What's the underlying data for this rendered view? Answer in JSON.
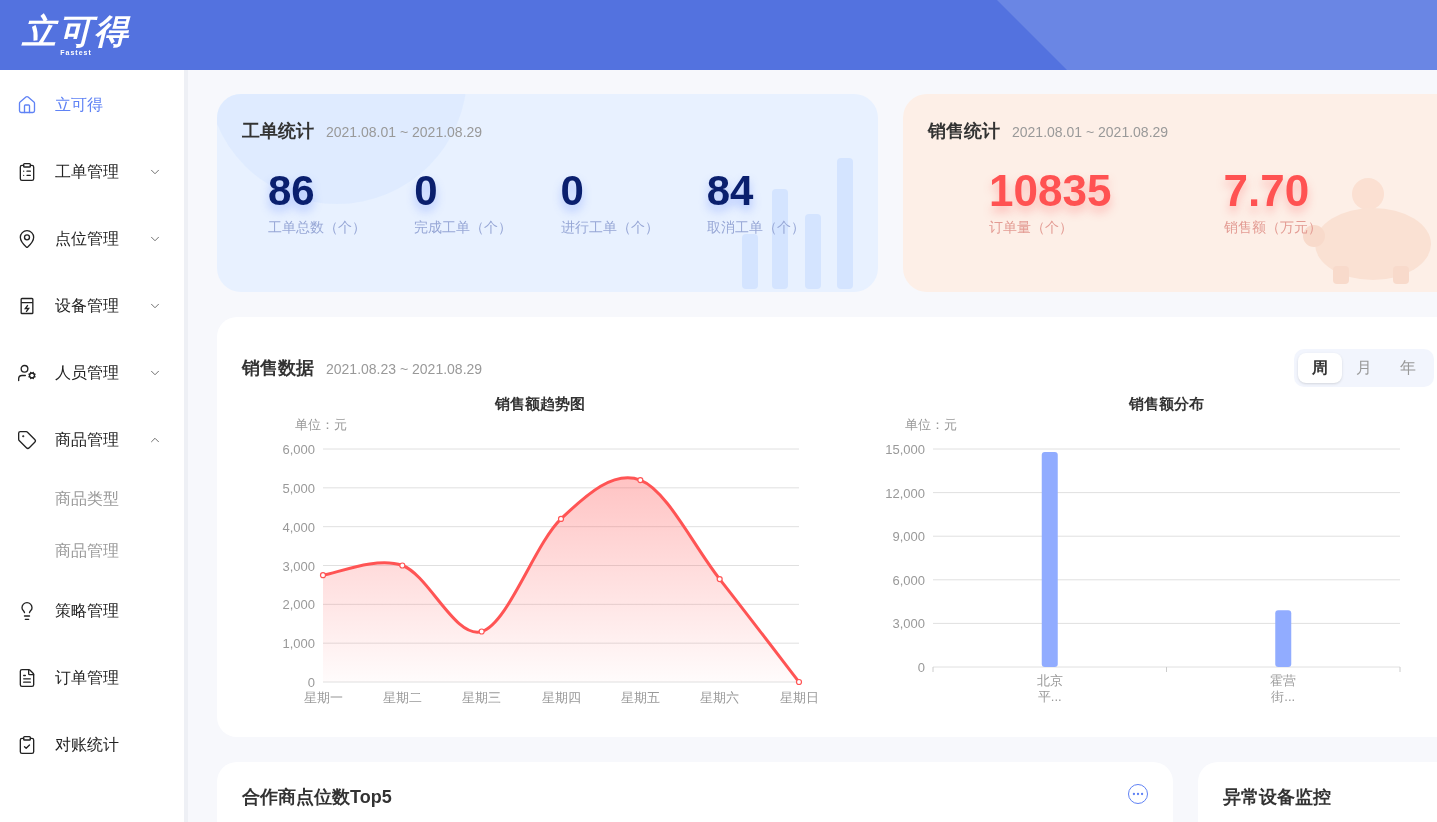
{
  "header": {
    "logo_text": "立可得",
    "logo_subtext": "Fastest"
  },
  "sidebar": {
    "items": [
      {
        "kind": "link",
        "label": "立可得",
        "selected": true
      },
      {
        "kind": "group",
        "label": "工单管理",
        "selected": false,
        "expanded": false
      },
      {
        "kind": "group",
        "label": "点位管理",
        "selected": false,
        "expanded": false
      },
      {
        "kind": "group",
        "label": "设备管理",
        "selected": false,
        "expanded": false
      },
      {
        "kind": "group",
        "label": "人员管理",
        "selected": false,
        "expanded": false
      },
      {
        "kind": "group",
        "label": "商品管理",
        "selected": false,
        "expanded": true,
        "children": [
          {
            "label": "商品类型",
            "selected": false
          },
          {
            "label": "商品管理",
            "selected": false
          }
        ]
      },
      {
        "kind": "link",
        "label": "策略管理",
        "selected": false
      },
      {
        "kind": "link",
        "label": "订单管理",
        "selected": false
      },
      {
        "kind": "link",
        "label": "对账统计",
        "selected": false
      }
    ]
  },
  "work_order_stats": {
    "title": "工单统计",
    "date_range": "2021.08.01 ~ 2021.08.29",
    "stats": [
      {
        "value": "86",
        "label": "工单总数（个）"
      },
      {
        "value": "0",
        "label": "完成工单（个）"
      },
      {
        "value": "0",
        "label": "进行工单（个）"
      },
      {
        "value": "84",
        "label": "取消工单（个）"
      }
    ]
  },
  "sales_stats": {
    "title": "销售统计",
    "date_range": "2021.08.01 ~ 2021.08.29",
    "stats": [
      {
        "value": "10835",
        "label": "订单量（个）"
      },
      {
        "value": "7.70",
        "label": "销售额（万元）"
      }
    ]
  },
  "sales_data": {
    "title": "销售数据",
    "date_range": "2021.08.23 ~ 2021.08.29",
    "period_tabs": [
      {
        "label": "周",
        "selected": true
      },
      {
        "label": "月",
        "selected": false
      },
      {
        "label": "年",
        "selected": false
      }
    ],
    "trend_chart": {
      "chart_data": {
        "type": "area",
        "title": "销售额趋势图",
        "ylabel": "单位：元",
        "categories": [
          "星期一",
          "星期二",
          "星期三",
          "星期四",
          "星期五",
          "星期六",
          "星期日"
        ],
        "series": [
          {
            "color": "#ff5454",
            "values": [
              2750,
              3000,
              1300,
              4200,
              5200,
              2650,
              0
            ]
          }
        ],
        "grid": true,
        "ylim": [
          0,
          6000
        ],
        "yticks": [
          0,
          {
            "value": 1000,
            "label": "1,000"
          },
          {
            "value": 2000,
            "label": "2,000"
          },
          {
            "value": 3000,
            "label": "3,000"
          },
          {
            "value": 4000,
            "label": "4,000"
          },
          {
            "value": 5000,
            "label": "5,000"
          },
          {
            "value": 6000,
            "label": "6,000"
          }
        ]
      }
    },
    "distribution_chart": {
      "chart_data": {
        "type": "bar",
        "title": "销售额分布",
        "ylabel": "单位：元",
        "categories": [
          "北京平...",
          "霍营街..."
        ],
        "series": [
          {
            "color": "#91acff",
            "values": [
              14800,
              3900
            ]
          }
        ],
        "grid": true,
        "ylim": [
          0,
          15000
        ],
        "yticks": [
          0,
          {
            "value": 3000,
            "label": "3,000"
          },
          {
            "value": 6000,
            "label": "6,000"
          },
          {
            "value": 9000,
            "label": "9,000"
          },
          {
            "value": 12000,
            "label": "12,000"
          },
          {
            "value": 15000,
            "label": "15,000"
          }
        ]
      }
    }
  },
  "bottom_cards": [
    {
      "title": "合作商点位数Top5",
      "has_more": true
    },
    {
      "title": "异常设备监控",
      "has_more": false
    }
  ]
}
